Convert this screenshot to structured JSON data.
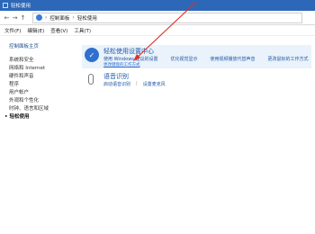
{
  "window": {
    "title": "轻松使用"
  },
  "breadcrumb": {
    "root": "控制面板",
    "current": "轻松使用"
  },
  "menu": [
    "文件(F)",
    "编辑(E)",
    "查看(V)",
    "工具(T)"
  ],
  "sidebar": {
    "home": "控制面板主页",
    "items": [
      "系统和安全",
      "网络和 Internet",
      "硬件和声音",
      "程序",
      "用户帐户",
      "外观和个性化",
      "时钟、语言和区域",
      "轻松使用"
    ]
  },
  "ease_section": {
    "title": "轻松使用设置中心",
    "links": [
      "使用 Windows 建议的设置",
      "优化视觉显示",
      "使用视频播放代替声音",
      "更改鼠标的工作方式"
    ],
    "sub_link": "更改键盘的工作方式"
  },
  "speech_section": {
    "title": "语音识别",
    "links": [
      "启动语音识别",
      "设置麦克风"
    ]
  },
  "colors": {
    "titlebar": "#2d67b7",
    "link": "#1f57a3",
    "arrow": "#e0302a"
  }
}
